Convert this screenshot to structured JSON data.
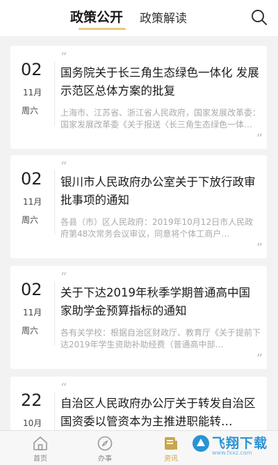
{
  "header": {
    "tabs": [
      {
        "label": "政策公开"
      },
      {
        "label": "政策解读"
      }
    ]
  },
  "articles": [
    {
      "day": "02",
      "month": "11月",
      "weekday": "周六",
      "title": "国务院关于长三角生态绿色一体化 发展示范区总体方案的批复",
      "summary": "上海市、江苏省、浙江省人民政府，国家发展改革委：国家发展改革委《关于报送〈长三角生态绿色一体化发展示范区总体方案〉的请示》"
    },
    {
      "day": "02",
      "month": "11月",
      "weekday": "周六",
      "title": "银川市人民政府办公室关于下放行政审批事项的通知",
      "summary": "各县（市）区人民政府：2019年10月12日市人民政府第48次常务会议审议，同意将个体工商户…"
    },
    {
      "day": "02",
      "month": "11月",
      "weekday": "周六",
      "title": "关于下达2019年秋季学期普通高中国家助学金预算指标的通知",
      "summary": "各有关学校：根据自治区财政厅、教育厅《关于提前下达2019年学生资助补助经费（普通高中部…"
    },
    {
      "day": "22",
      "month": "10月",
      "weekday": "",
      "title": "自治区人民政府办公厅关于转发自治区国资委以管资本为主推进职能转…",
      "summary": ""
    }
  ],
  "bottom_nav": [
    {
      "label": "首页",
      "icon": "home-icon"
    },
    {
      "label": "办事",
      "icon": "compass-icon"
    },
    {
      "label": "资讯",
      "icon": "news-icon"
    }
  ],
  "watermark": {
    "text": "飞翔下载",
    "sub": "www.fxxz.com"
  },
  "colors": {
    "accent": "#e7c978",
    "active_nav": "#c9a64b",
    "background": "#f2f2f2"
  }
}
